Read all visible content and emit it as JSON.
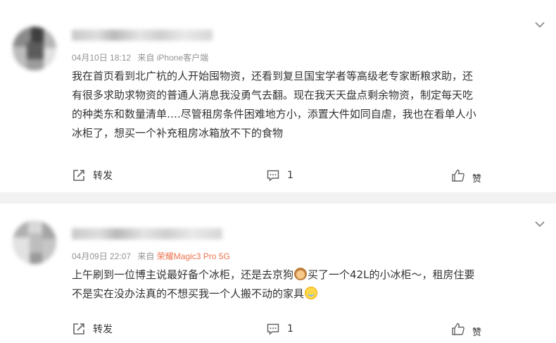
{
  "comments": [
    {
      "time": "04月10日 18:12",
      "from_label": "来自",
      "device": "iPhone客户端",
      "device_linked": false,
      "lines": [
        "我在首页看到北广杭的人开始囤物资，还看到复旦国宝学者等高级老专家断粮求助，还",
        "有很多求助求物资的普通人消息我没勇气去翻。现在我天天盘点剩余物资，制定每天吃",
        "的种类东和数量清单….尽管租房条件困难地方小，添置大件如同自虐，我也在看单人小",
        "冰柜了，想买一个补充租房冰箱放不下的食物"
      ],
      "repost_label": "转发",
      "comment_count": "1",
      "like_label": "赞"
    },
    {
      "time": "04月09日 22:07",
      "from_label": "来自",
      "device": "荣耀Magic3 Pro 5G",
      "device_linked": true,
      "lines": [
        {
          "before": "上午刷到一位博主说最好备个冰柜，还是去京狗",
          "emoji": "dog",
          "after": "买了一个42L的小冰柜～，租房住要"
        },
        {
          "before": "不是实在没办法真的不想买我一个人搬不动的家具",
          "emoji": "cry",
          "after": ""
        }
      ],
      "repost_label": "转发",
      "comment_count": "1",
      "like_label": "赞"
    }
  ],
  "icons": {
    "repost": "repost-icon",
    "comment": "comment-icon",
    "like": "thumbs-up-icon",
    "more": "chevron-down-icon"
  },
  "colors": {
    "text": "#333333",
    "meta": "#939393",
    "device_link": "#eb7350",
    "page_bg": "#f2f2f2"
  }
}
